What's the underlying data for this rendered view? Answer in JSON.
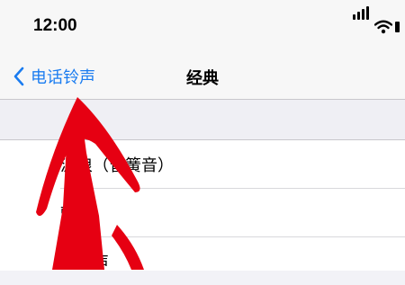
{
  "status_bar": {
    "time": "12:00"
  },
  "nav": {
    "back_label": "电话铃声",
    "title": "经典"
  },
  "list": {
    "items": [
      "波浪（管簧音）",
      "颤音",
      "弹球声"
    ]
  },
  "colors": {
    "accent": "#1a7cf0",
    "annotation_arrow": "#e60012"
  }
}
